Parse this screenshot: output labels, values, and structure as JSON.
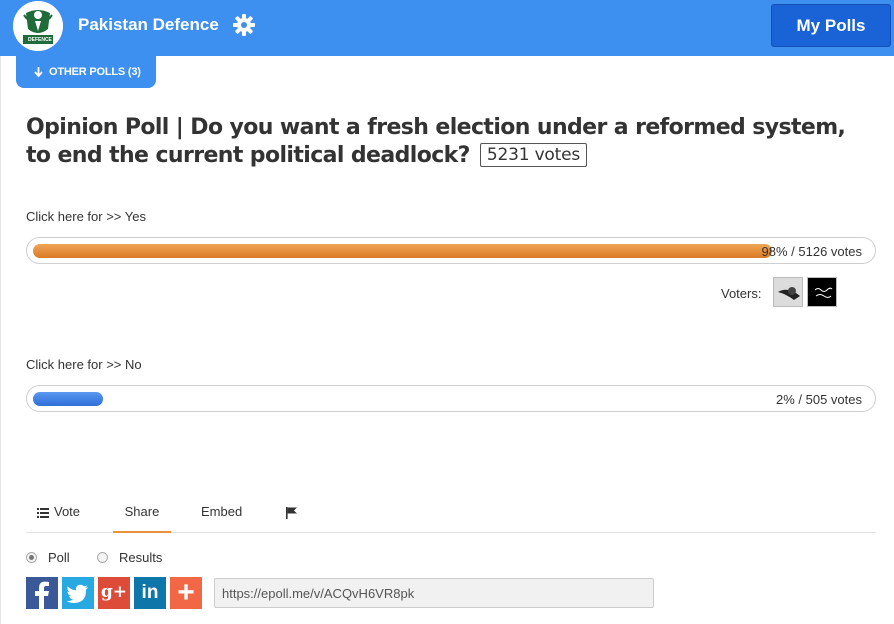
{
  "header": {
    "site_name": "Pakistan Defence",
    "logo_text": "DEFENCE",
    "my_polls_label": "My Polls",
    "other_polls_label": "OTHER POLLS (3)"
  },
  "poll": {
    "question": "Opinion Poll | Do you want a fresh election under a reformed system, to end the current political deadlock?",
    "total_votes": "5231 votes",
    "options": [
      {
        "label": "Click here for >> Yes",
        "percent": 98,
        "result_text": "98% / 5126 votes",
        "color": "#e8913a"
      },
      {
        "label": "Click here for >> No",
        "percent": 2,
        "result_text": "2% / 505 votes",
        "color": "#3d7ee8"
      }
    ],
    "voters_label": "Voters:"
  },
  "tabs": [
    {
      "label": "Vote",
      "icon": "list-icon"
    },
    {
      "label": "Share",
      "active": true
    },
    {
      "label": "Embed"
    },
    {
      "label": "",
      "icon": "flag-icon"
    }
  ],
  "share": {
    "radio_options": [
      {
        "label": "Poll",
        "checked": true
      },
      {
        "label": "Results",
        "checked": false
      }
    ],
    "buttons": [
      {
        "name": "facebook",
        "color": "#3b5998",
        "glyph": "f"
      },
      {
        "name": "twitter",
        "color": "#29a9e1",
        "glyph": "t"
      },
      {
        "name": "google-plus",
        "color": "#dd4b39",
        "glyph": "g+"
      },
      {
        "name": "linkedin",
        "color": "#0e76a8",
        "glyph": "in"
      },
      {
        "name": "add-more",
        "color": "#f26745",
        "glyph": "+"
      }
    ],
    "url": "https://epoll.me/v/ACQvH6VR8pk"
  }
}
